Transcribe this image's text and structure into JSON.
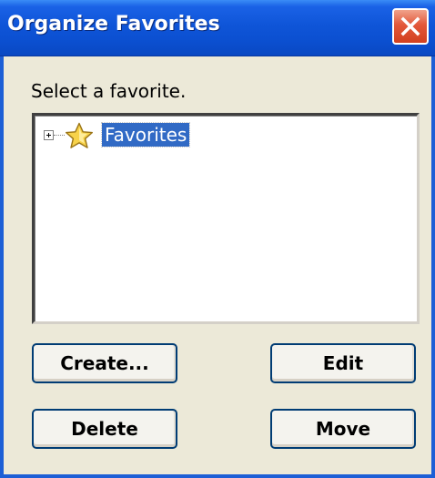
{
  "window": {
    "title": "Organize Favorites"
  },
  "prompt": "Select a favorite.",
  "tree": {
    "items": [
      {
        "label": "Favorites",
        "icon": "star-icon",
        "expanded": false,
        "selected": true
      }
    ]
  },
  "buttons": {
    "create": "Create...",
    "edit": "Edit",
    "delete": "Delete",
    "move": "Move"
  },
  "icons": {
    "close": "close-icon",
    "expand": "plus-box-icon",
    "folder": "star-icon"
  },
  "colors": {
    "titlebar": "#0b4fd0",
    "close_button": "#e3583a",
    "dialog_face": "#ece9d8",
    "selection": "#316ac5",
    "button_border": "#003c74",
    "star_fill": "#f7d24a"
  }
}
